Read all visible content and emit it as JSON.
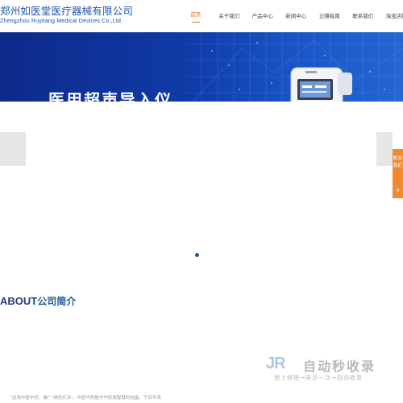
{
  "header": {
    "logo_cn": "郑州如医堂医疗器械有限公司",
    "logo_en": "Zhengzhou Ruyitang Medical Devices Co.,Ltd.",
    "nav": [
      "首页",
      "关于我们",
      "产品中心",
      "新闻中心",
      "立赚指南",
      "联系我们",
      "淘宝店铺"
    ],
    "active_nav": "首页"
  },
  "banner": {
    "title": "医用超声导入仪"
  },
  "slider": {
    "pagination": "•"
  },
  "contact_tab": {
    "label": "联系我们",
    "chevron": "«"
  },
  "about": {
    "en": "ABOUT",
    "cn": "公司简介",
    "text": "“运用中医中药、推广‘绿色疗法’，中医中药是中华民族智慧的结晶，千百年来·"
  },
  "watermark": {
    "logo": "JR",
    "title": "自动秒收录",
    "sub": "放上链接→来访一次→自动收录"
  },
  "colors": {
    "brand": "#1e56a6",
    "accent": "#e76b1a",
    "tab": "#f08a31"
  }
}
